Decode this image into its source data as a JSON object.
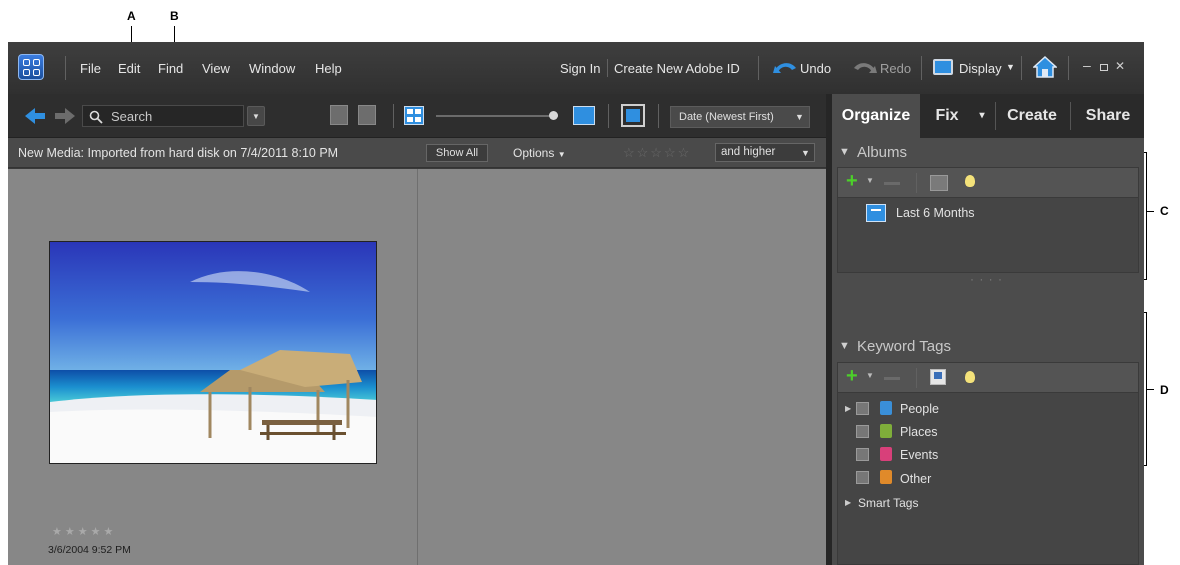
{
  "callouts": {
    "a": "A",
    "b": "B",
    "c": "C",
    "d": "D"
  },
  "menu": {
    "file": "File",
    "edit": "Edit",
    "find": "Find",
    "view": "View",
    "window": "Window",
    "help": "Help"
  },
  "account": {
    "sign_in": "Sign In",
    "create_id": "Create New Adobe ID"
  },
  "actions": {
    "undo": "Undo",
    "redo": "Redo",
    "display": "Display"
  },
  "toolbar": {
    "search_placeholder": "Search",
    "sort_label": "Date (Newest First)"
  },
  "infobar": {
    "prefix": "New Media:",
    "text": "Imported from hard disk on 7/4/2011 8:10 PM",
    "show_all": "Show All",
    "options": "Options",
    "rating_filter": "and higher"
  },
  "media": {
    "photo_rating": "★★★★★",
    "photo_date": "3/6/2004 9:52 PM",
    "filter_stars": "☆☆☆☆☆"
  },
  "tabs": [
    {
      "label": "Organize",
      "active": true
    },
    {
      "label": "Fix",
      "active": false
    },
    {
      "label": "Create",
      "active": false
    },
    {
      "label": "Share",
      "active": false
    }
  ],
  "albums": {
    "title": "Albums",
    "items": [
      "Last 6 Months"
    ]
  },
  "keyword_tags": {
    "title": "Keyword Tags",
    "items": [
      {
        "label": "People",
        "color": "#3a8fd8"
      },
      {
        "label": "Places",
        "color": "#7fae3a"
      },
      {
        "label": "Events",
        "color": "#d8407a"
      },
      {
        "label": "Other",
        "color": "#e08a2a"
      }
    ],
    "smart_tags": "Smart Tags"
  },
  "colors": {
    "accent": "#2f8fe0",
    "add_green": "#4ccf2a"
  }
}
